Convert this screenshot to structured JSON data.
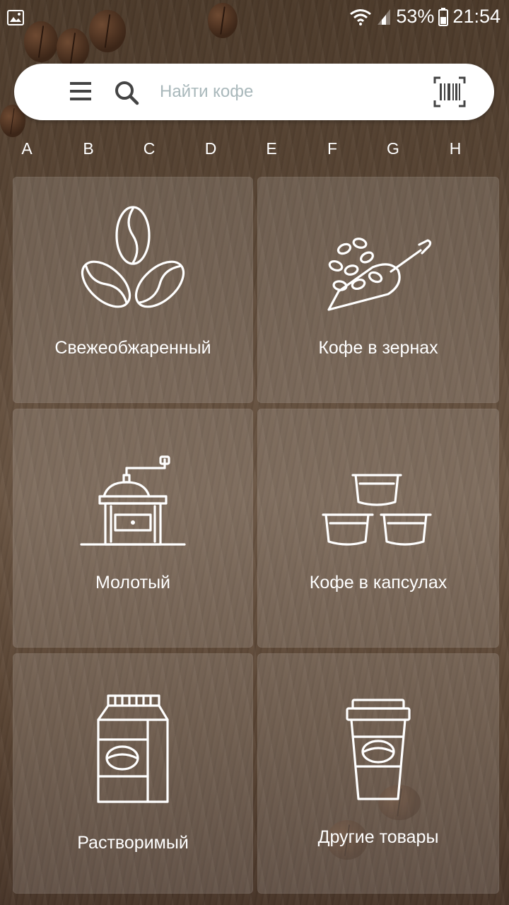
{
  "status_bar": {
    "battery": "53%",
    "time": "21:54"
  },
  "search": {
    "placeholder": "Найти кофе"
  },
  "alphabet": [
    "A",
    "B",
    "C",
    "D",
    "E",
    "F",
    "G",
    "H"
  ],
  "categories": [
    {
      "label": "Свежеобжаренный",
      "icon": "roasted-beans-icon"
    },
    {
      "label": "Кофе в зернах",
      "icon": "coffee-scoop-icon"
    },
    {
      "label": "Молотый",
      "icon": "coffee-grinder-icon"
    },
    {
      "label": "Кофе в капсулах",
      "icon": "capsules-icon"
    },
    {
      "label": "Растворимый",
      "icon": "coffee-package-icon"
    },
    {
      "label": "Другие товары",
      "icon": "coffee-cup-icon"
    }
  ],
  "colors": {
    "tile_overlay": "rgba(255,255,255,0.14)",
    "placeholder": "#a9b8bb",
    "wood_background": "#5d4938"
  }
}
